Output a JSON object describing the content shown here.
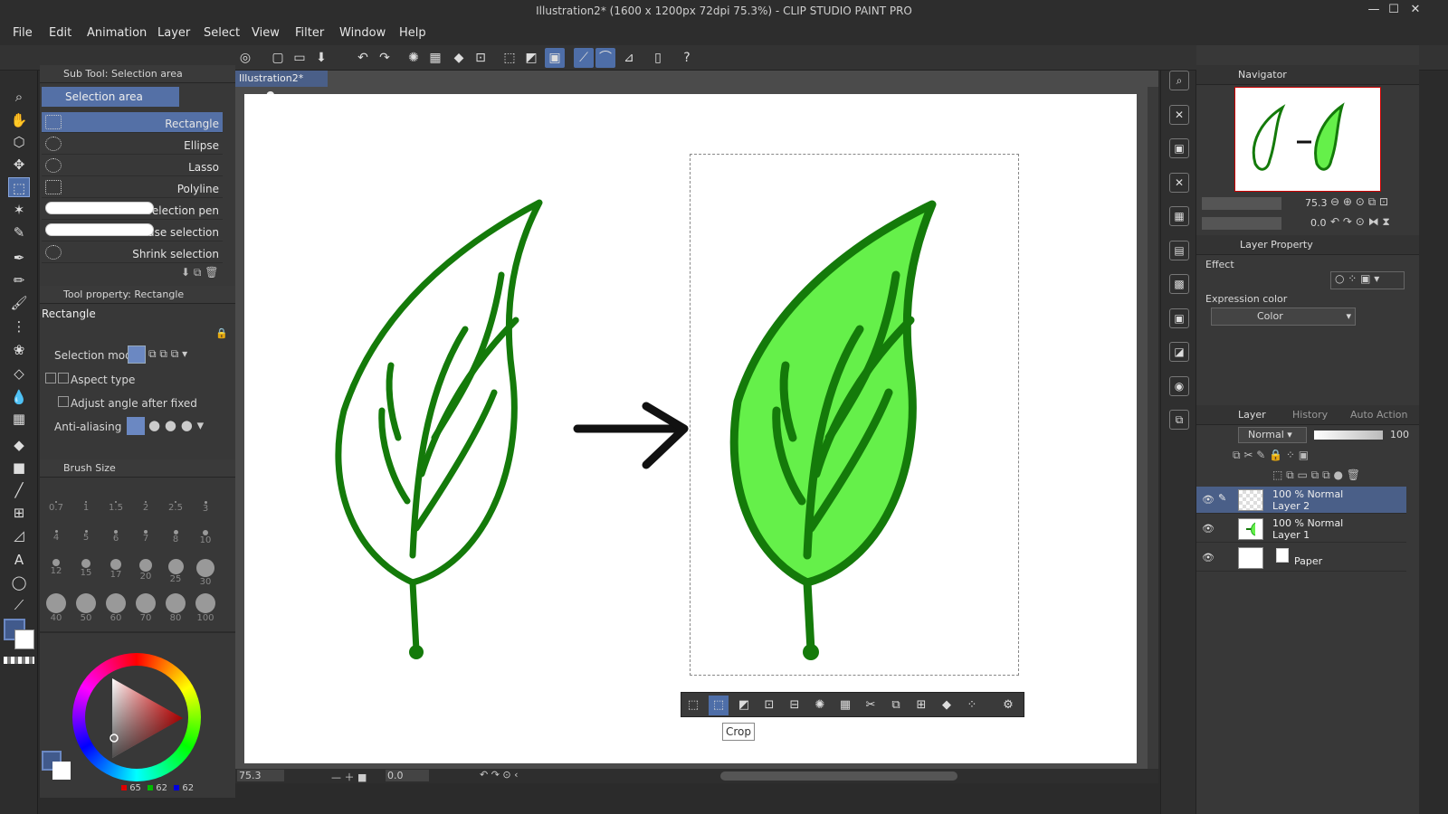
{
  "window": {
    "title": "Illustration2* (1600 x 1200px 72dpi 75.3%) - CLIP STUDIO PAINT PRO",
    "min": "—",
    "max": "☐",
    "close": "✕"
  },
  "menu": [
    "File",
    "Edit",
    "Animation",
    "Layer",
    "Select",
    "View",
    "Filter",
    "Window",
    "Help"
  ],
  "document_tab": "Illustration2*",
  "subtool": {
    "header": "Sub Tool: Selection area",
    "group_tab": "Selection area",
    "items": [
      "Rectangle",
      "Ellipse",
      "Lasso",
      "Polyline",
      "Selection pen",
      "Erase selection",
      "Shrink selection"
    ],
    "selected": "Rectangle"
  },
  "tool_property": {
    "header": "Tool property: Rectangle",
    "name": "Rectangle",
    "rows": [
      "Selection mode",
      "Aspect type",
      "Adjust angle after fixed",
      "Anti-aliasing"
    ]
  },
  "brush_size": {
    "header": "Brush Size",
    "values": [
      "0.7",
      "1",
      "1.5",
      "2",
      "2.5",
      "3",
      "4",
      "5",
      "6",
      "7",
      "8",
      "10",
      "12",
      "15",
      "17",
      "20",
      "25",
      "30",
      "40",
      "50",
      "60",
      "70",
      "80",
      "100"
    ]
  },
  "color": {
    "r": "65",
    "g": "62",
    "b": "62",
    "main_color": "#415a8c",
    "sub_color": "#ffffff",
    "accent": "#4e6ea8"
  },
  "tooltip": "Crop",
  "status": {
    "zoom": "75.3",
    "angle": "0.0"
  },
  "navigator": {
    "header": "Navigator",
    "zoom": "75.3",
    "angle": "0.0"
  },
  "layer_property": {
    "header": "Layer Property",
    "effect_label": "Effect",
    "expression_label": "Expression color",
    "expression_value": "Color"
  },
  "layer_panel": {
    "tabs": [
      "Layer",
      "History",
      "Auto Action"
    ],
    "blend": "Normal",
    "opacity": "100",
    "layers": [
      {
        "line1": "100 % Normal",
        "line2": "Layer 2",
        "selected": true
      },
      {
        "line1": "100 % Normal",
        "line2": "Layer 1",
        "selected": false
      },
      {
        "line1": "",
        "line2": "Paper",
        "selected": false
      }
    ]
  }
}
